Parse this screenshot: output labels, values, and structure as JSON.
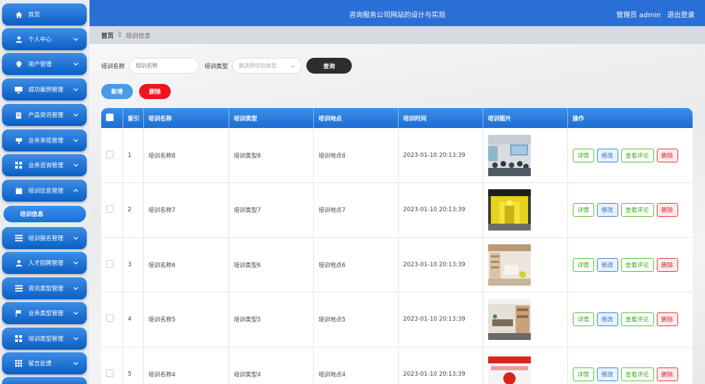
{
  "header": {
    "title": "咨询服务公司网站的设计与实现",
    "user_label": "管理员 admin",
    "logout_label": "退出登录"
  },
  "sidebar": {
    "items": [
      {
        "label": "首页",
        "icon": "home-icon"
      },
      {
        "label": "个人中心",
        "icon": "user-icon"
      },
      {
        "label": "用户管理",
        "icon": "pin-icon"
      },
      {
        "label": "成功案例管理",
        "icon": "monitor-icon"
      },
      {
        "label": "产品资讯管理",
        "icon": "clipboard-icon"
      },
      {
        "label": "业务承揽管理",
        "icon": "desk-icon"
      },
      {
        "label": "业务咨询管理",
        "icon": "grid-icon"
      },
      {
        "label": "培训信息管理",
        "icon": "calendar-icon"
      },
      {
        "label": "培训报名管理",
        "icon": "list-icon"
      },
      {
        "label": "人才招聘管理",
        "icon": "user-icon"
      },
      {
        "label": "资讯类型管理",
        "icon": "list-icon"
      },
      {
        "label": "业务类型管理",
        "icon": "flag-icon"
      },
      {
        "label": "培训类型管理",
        "icon": "grid-icon"
      },
      {
        "label": "留言反馈",
        "icon": "grid9-icon"
      }
    ],
    "active_sub": "培训信息"
  },
  "breadcrumb": {
    "home": "首页",
    "separator": "Ξ",
    "current": "培训信息"
  },
  "search": {
    "name_label": "培训名称",
    "name_placeholder": "培训名称",
    "type_label": "培训类型",
    "type_placeholder": "请选择培训类型",
    "query_label": "查询"
  },
  "actions": {
    "add_label": "新增",
    "delete_label": "删除"
  },
  "table": {
    "columns": [
      "索引",
      "培训名称",
      "培训类型",
      "培训地点",
      "培训时间",
      "培训图片",
      "操作"
    ],
    "op_labels": {
      "detail": "详情",
      "edit": "修改",
      "comment": "查看评论",
      "delete": "删除"
    },
    "rows": [
      {
        "index": "1",
        "name": "培训名称8",
        "type": "培训类型8",
        "place": "培训地点8",
        "time": "2023-01-10 20:13:39",
        "image": "classroom-photo"
      },
      {
        "index": "2",
        "name": "培训名称7",
        "type": "培训类型7",
        "place": "培训地点7",
        "time": "2023-01-10 20:13:39",
        "image": "yellow-hall-photo"
      },
      {
        "index": "3",
        "name": "培训名称6",
        "type": "培训类型6",
        "place": "培训地点6",
        "time": "2023-01-10 20:13:39",
        "image": "office-photo"
      },
      {
        "index": "4",
        "name": "培训名称5",
        "type": "培训类型5",
        "place": "培训地点5",
        "time": "2023-01-10 20:13:39",
        "image": "meeting-room-photo"
      },
      {
        "index": "5",
        "name": "培训名称4",
        "type": "培训类型4",
        "place": "培训地点4",
        "time": "2023-01-10 20:13:39",
        "image": "red-banner-photo"
      }
    ]
  },
  "colors": {
    "primary": "#2a6fd5",
    "danger": "#f0141c",
    "success": "#54c22e",
    "dark": "#2d2d2d"
  }
}
